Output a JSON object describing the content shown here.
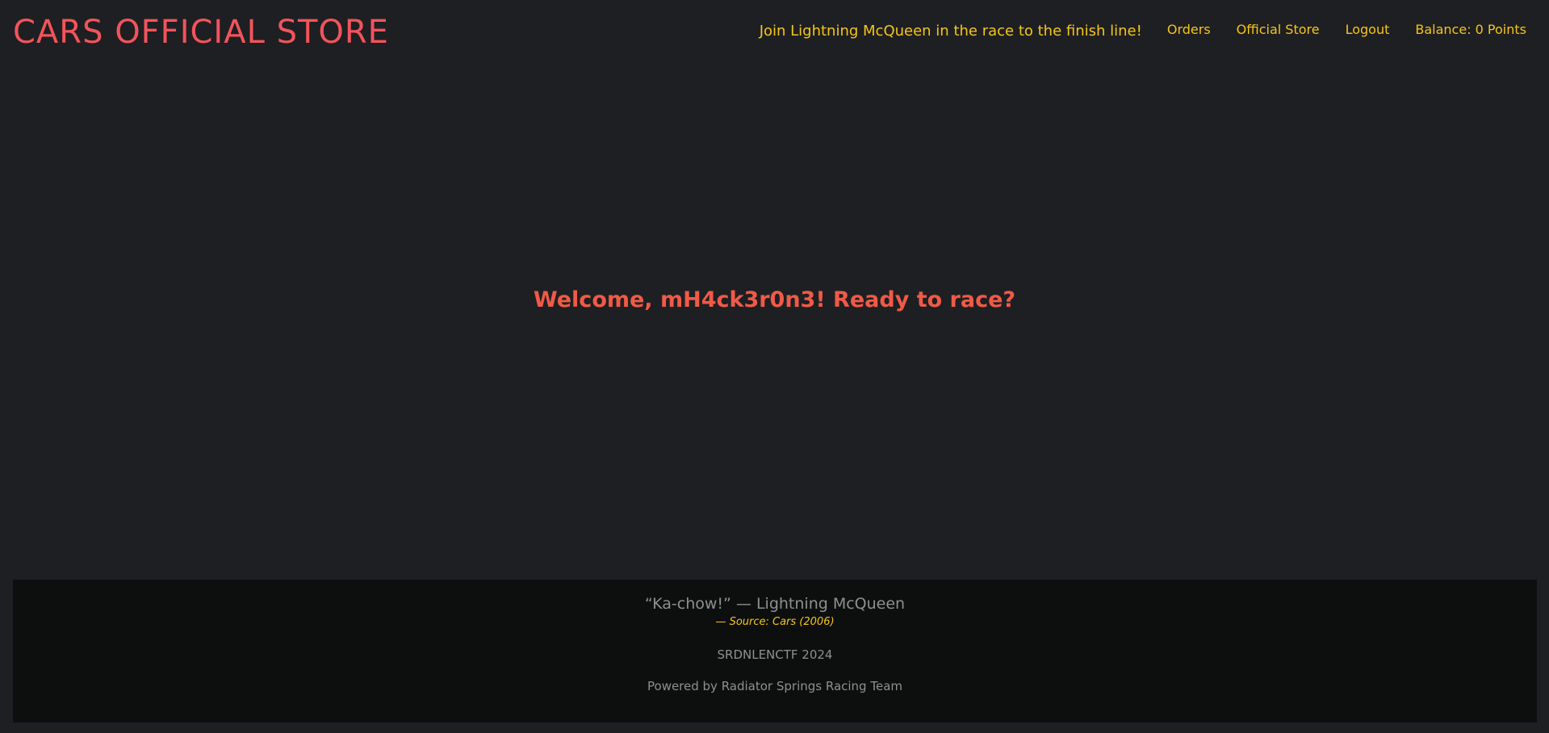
{
  "header": {
    "brand": "CARS OFFICIAL STORE",
    "tagline": "Join Lightning McQueen in the race to the finish line!",
    "nav": {
      "orders": "Orders",
      "store": "Official Store",
      "logout": "Logout",
      "balance": "Balance: 0 Points"
    }
  },
  "main": {
    "welcome": "Welcome, mH4ck3r0n3! Ready to race?"
  },
  "footer": {
    "quote": "“Ka-chow!” — Lightning McQueen",
    "source": "—  Source: Cars (2006)",
    "ctf": "SRDNLENCTF 2024",
    "powered": "Powered by Radiator Springs Racing Team"
  },
  "colors": {
    "background": "#1e1f22",
    "brand": "#f2545b",
    "nav": "#f5c518",
    "welcome": "#f05a47",
    "footer_bg": "#0d0f0f",
    "footer_text": "#8d9091"
  }
}
